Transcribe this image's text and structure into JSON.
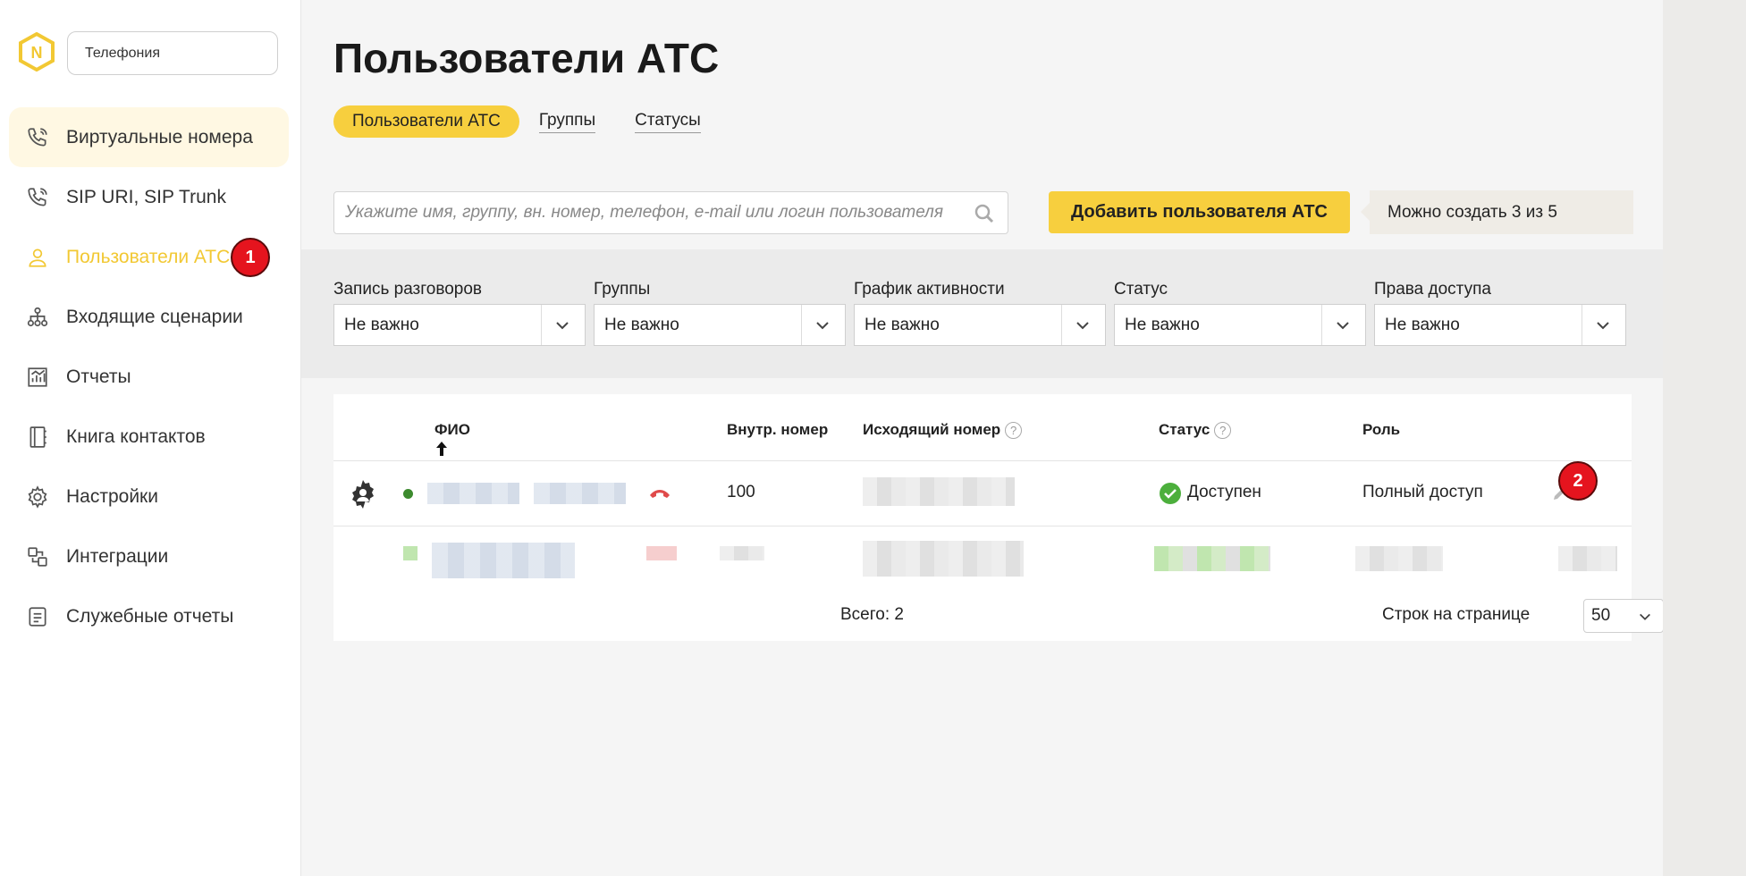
{
  "sidebar": {
    "product_select": "Телефония",
    "items": [
      {
        "label": "Виртуальные номера"
      },
      {
        "label": "SIP URI, SIP Trunk"
      },
      {
        "label": "Пользователи АТС"
      },
      {
        "label": "Входящие сценарии"
      },
      {
        "label": "Отчеты"
      },
      {
        "label": "Книга контактов"
      },
      {
        "label": "Настройки"
      },
      {
        "label": "Интеграции"
      },
      {
        "label": "Служебные отчеты"
      }
    ],
    "badge_1": "1"
  },
  "main": {
    "title": "Пользователи АТС",
    "tabs": [
      {
        "label": "Пользователи АТС"
      },
      {
        "label": "Группы"
      },
      {
        "label": "Статусы"
      }
    ],
    "search_placeholder": "Укажите имя, группу, вн. номер, телефон, e-mail или логин пользователя",
    "add_button": "Добавить пользователя АТС",
    "quota": "Можно создать 3 из 5",
    "filters": [
      {
        "label": "Запись разговоров",
        "value": "Не важно"
      },
      {
        "label": "Группы",
        "value": "Не важно"
      },
      {
        "label": "График активности",
        "value": "Не важно"
      },
      {
        "label": "Статус",
        "value": "Не важно"
      },
      {
        "label": "Права доступа",
        "value": "Не важно"
      }
    ]
  },
  "table": {
    "columns": {
      "name": "ФИО",
      "ext": "Внутр. номер",
      "outgoing": "Исходящий номер",
      "status": "Статус",
      "role": "Роль"
    },
    "rows": [
      {
        "ext": "100",
        "status": "Доступен",
        "role": "Полный доступ"
      }
    ],
    "total": "Всего: 2",
    "rows_per_page_label": "Строк на странице",
    "rows_per_page": "50",
    "badge_2": "2"
  },
  "colors": {
    "accent": "#f7cf3e",
    "badge": "#e5141e",
    "status_green": "#4caf3c"
  }
}
